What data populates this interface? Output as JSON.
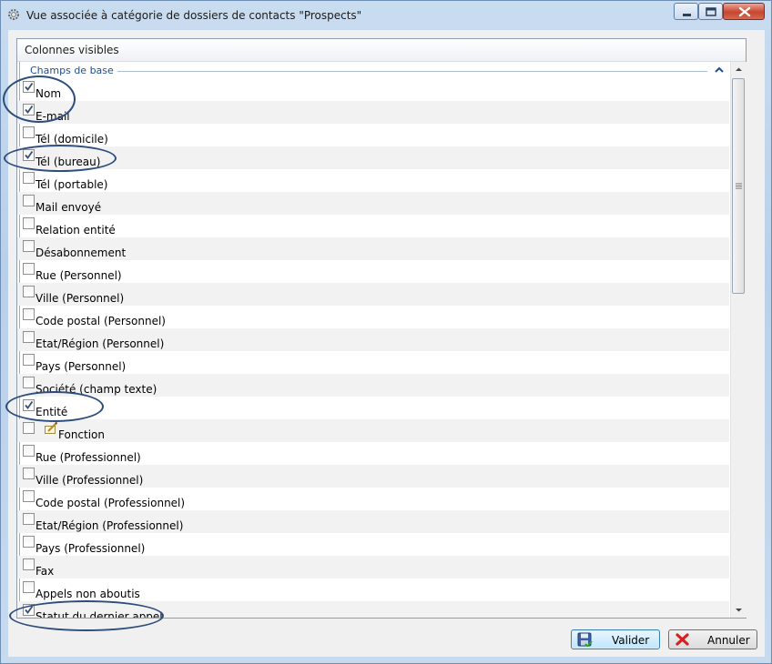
{
  "window": {
    "title": "Vue associée à catégorie de dossiers de contacts \"Prospects\""
  },
  "panel": {
    "column_header": "Colonnes visibles",
    "group_label": "Champs de base"
  },
  "rows": [
    {
      "label": "Nom",
      "checked": true
    },
    {
      "label": "E-mail",
      "checked": true
    },
    {
      "label": "Tél (domicile)",
      "checked": false
    },
    {
      "label": "Tél (bureau)",
      "checked": true
    },
    {
      "label": "Tél (portable)",
      "checked": false
    },
    {
      "label": "Mail envoyé",
      "checked": false
    },
    {
      "label": "Relation entité",
      "checked": false
    },
    {
      "label": "Désabonnement",
      "checked": false
    },
    {
      "label": "Rue (Personnel)",
      "checked": false
    },
    {
      "label": "Ville (Personnel)",
      "checked": false
    },
    {
      "label": "Code postal (Personnel)",
      "checked": false
    },
    {
      "label": "Etat/Région (Personnel)",
      "checked": false
    },
    {
      "label": "Pays (Personnel)",
      "checked": false
    },
    {
      "label": "Société (champ texte)",
      "checked": false
    },
    {
      "label": "Entité",
      "checked": true
    },
    {
      "label": "Fonction",
      "checked": false,
      "icon": "pencil-field-icon"
    },
    {
      "label": "Rue (Professionnel)",
      "checked": false
    },
    {
      "label": "Ville (Professionnel)",
      "checked": false
    },
    {
      "label": "Code postal (Professionnel)",
      "checked": false
    },
    {
      "label": "Etat/Région (Professionnel)",
      "checked": false
    },
    {
      "label": "Pays (Professionnel)",
      "checked": false
    },
    {
      "label": "Fax",
      "checked": false
    },
    {
      "label": "Appels non aboutis",
      "checked": false
    },
    {
      "label": "Statut du dernier appel",
      "checked": true
    }
  ],
  "footer": {
    "ok_label": "Valider",
    "ok_icon": "save-disk-icon",
    "cancel_label": "Annuler",
    "cancel_icon": "red-x-icon"
  },
  "colors": {
    "annotation_ellipse": "#2d4d7b",
    "group_label": "#1e4f8c",
    "alt_row": "#f2f2f2"
  }
}
